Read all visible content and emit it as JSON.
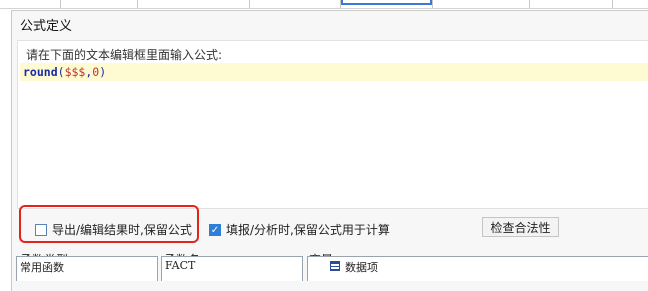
{
  "dialog": {
    "title": "公式定义"
  },
  "editor": {
    "prompt": "请在下面的文本编辑框里面输入公式:",
    "code": {
      "func": "round",
      "open": "(",
      "var": "$$$",
      "comma": ",",
      "num": "0",
      "close": ")"
    }
  },
  "options": {
    "export_keep_formula": {
      "label": "导出/编辑结果时,保留公式",
      "checked": false
    },
    "fill_keep_formula": {
      "label": "填报/分析时,保留公式用于计算",
      "checked": true
    },
    "validate_button": "检查合法性"
  },
  "bottom": {
    "function_type_label": "函数类型:",
    "function_type_value": "常用函数",
    "function_name_label": "函数名:",
    "function_name_value": "FACT",
    "variable_label": "变量:",
    "variable_value": "数据项"
  },
  "colors": {
    "editor_highlight": "#fefbd2",
    "annotation_border": "#e3241b",
    "checkbox_checked": "#2f7fd8"
  }
}
